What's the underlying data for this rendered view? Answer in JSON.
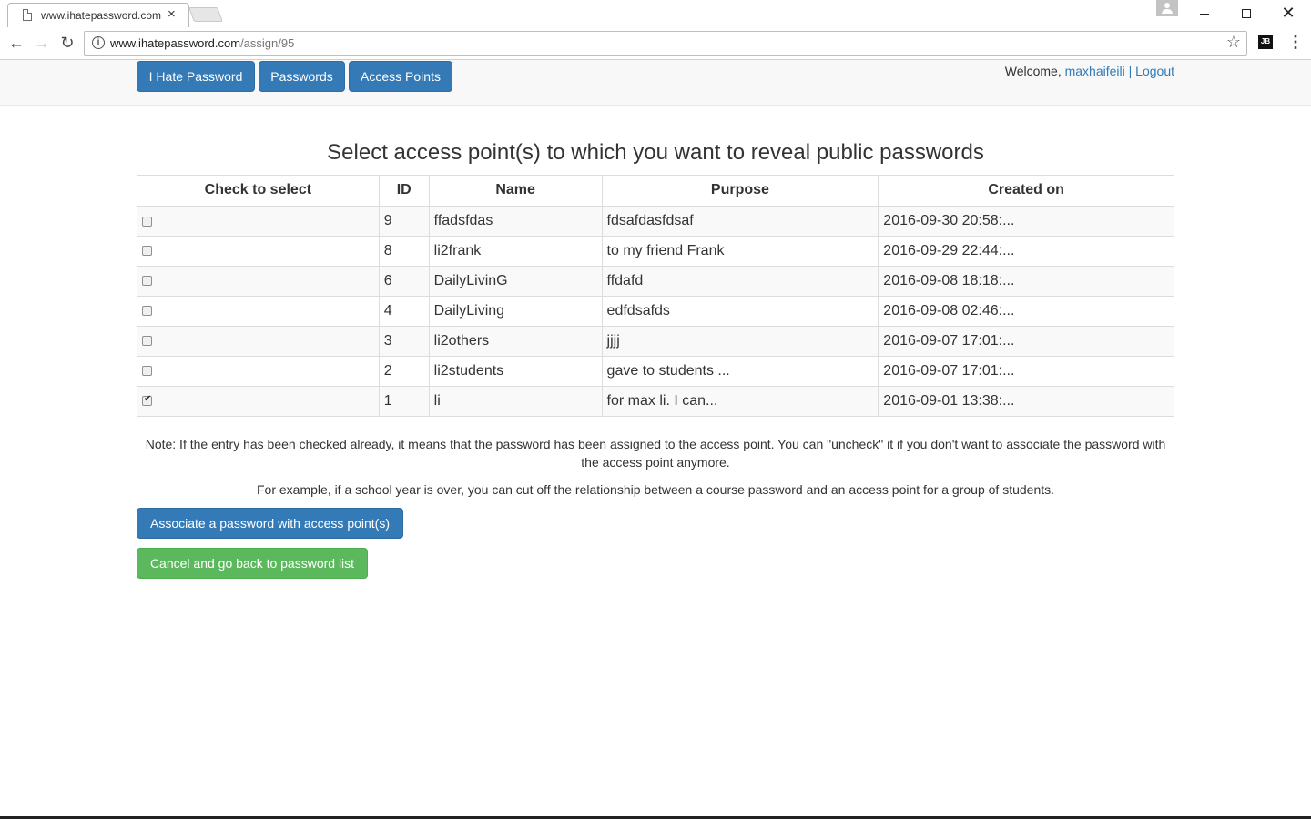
{
  "browser": {
    "tab_title": "www.ihatepassword.com",
    "url_host": "www.ihatepassword.com",
    "url_path": "/assign/95",
    "extension_label": "JB"
  },
  "nav": {
    "brand": "I Hate Password",
    "passwords": "Passwords",
    "access_points": "Access Points",
    "welcome_prefix": "Welcome, ",
    "username": "maxhaifeili",
    "separator": " | ",
    "logout": "Logout"
  },
  "page": {
    "heading": "Select access point(s) to which you want to reveal public passwords",
    "columns": {
      "select": "Check to select",
      "id": "ID",
      "name": "Name",
      "purpose": "Purpose",
      "created": "Created on"
    },
    "rows": [
      {
        "checked": false,
        "id": "9",
        "name": "ffadsfdas",
        "purpose": "fdsafdasfdsaf",
        "created": "2016-09-30 20:58:..."
      },
      {
        "checked": false,
        "id": "8",
        "name": "li2frank",
        "purpose": "to my friend Frank",
        "created": "2016-09-29 22:44:..."
      },
      {
        "checked": false,
        "id": "6",
        "name": "DailyLivinG",
        "purpose": "ffdafd",
        "created": "2016-09-08 18:18:..."
      },
      {
        "checked": false,
        "id": "4",
        "name": "DailyLiving",
        "purpose": "edfdsafds",
        "created": "2016-09-08 02:46:..."
      },
      {
        "checked": false,
        "id": "3",
        "name": "li2others",
        "purpose": "jjjj",
        "created": "2016-09-07 17:01:..."
      },
      {
        "checked": false,
        "id": "2",
        "name": "li2students",
        "purpose": "gave to students ...",
        "created": "2016-09-07 17:01:..."
      },
      {
        "checked": true,
        "id": "1",
        "name": "li",
        "purpose": "for max li. I can...",
        "created": "2016-09-01 13:38:..."
      }
    ],
    "note1": "Note: If the entry has been checked already, it means that the password has been assigned to the access point. You can \"uncheck\" it if you don't want to associate the password with the access point anymore.",
    "note2": "For example, if a school year is over, you can cut off the relationship between a course password and an access point for a group of students.",
    "associate_button": "Associate a password with access point(s)",
    "cancel_button": "Cancel and go back to password list"
  },
  "colors": {
    "primary": "#337ab7",
    "success": "#5cb85c",
    "navbar_bg": "#f8f8f8"
  }
}
